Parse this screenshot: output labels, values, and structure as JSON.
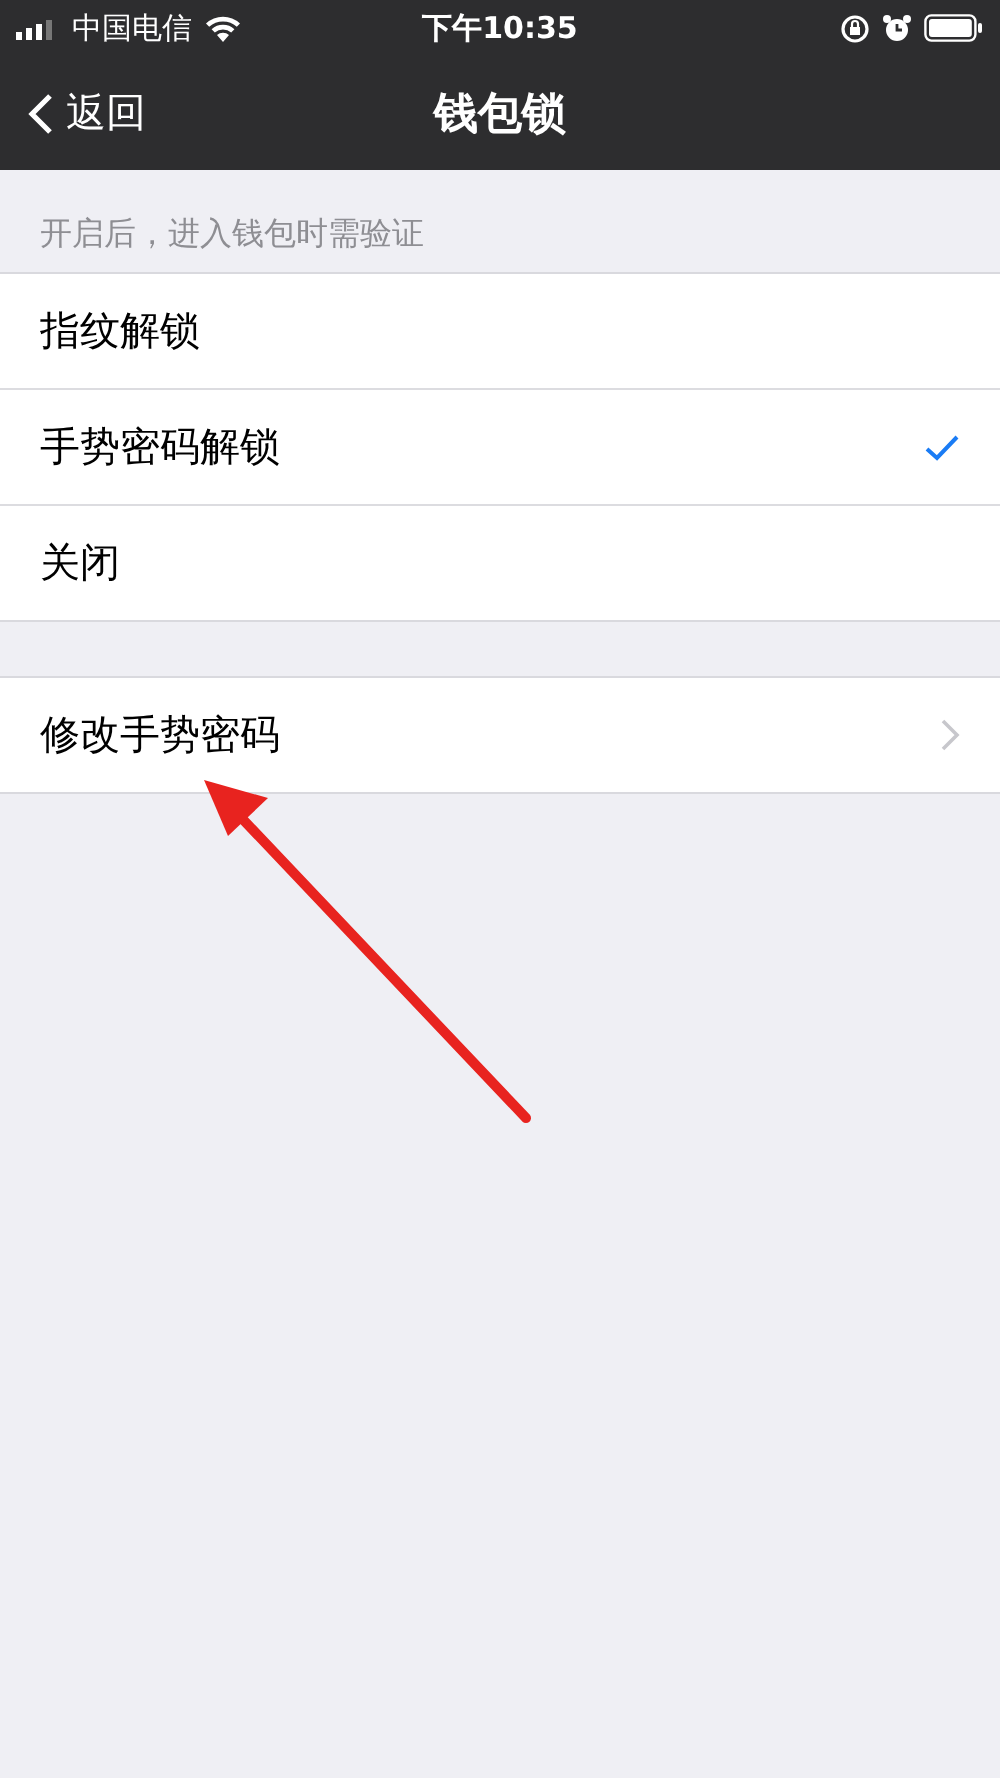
{
  "status_bar": {
    "carrier": "中国电信",
    "time": "下午10:35"
  },
  "nav": {
    "back": "返回",
    "title": "钱包锁"
  },
  "section_header": "开启后，进入钱包时需验证",
  "options": [
    {
      "label": "指纹解锁",
      "selected": false
    },
    {
      "label": "手势密码解锁",
      "selected": true
    },
    {
      "label": "关闭",
      "selected": false
    }
  ],
  "actions": [
    {
      "label": "修改手势密码"
    }
  ]
}
